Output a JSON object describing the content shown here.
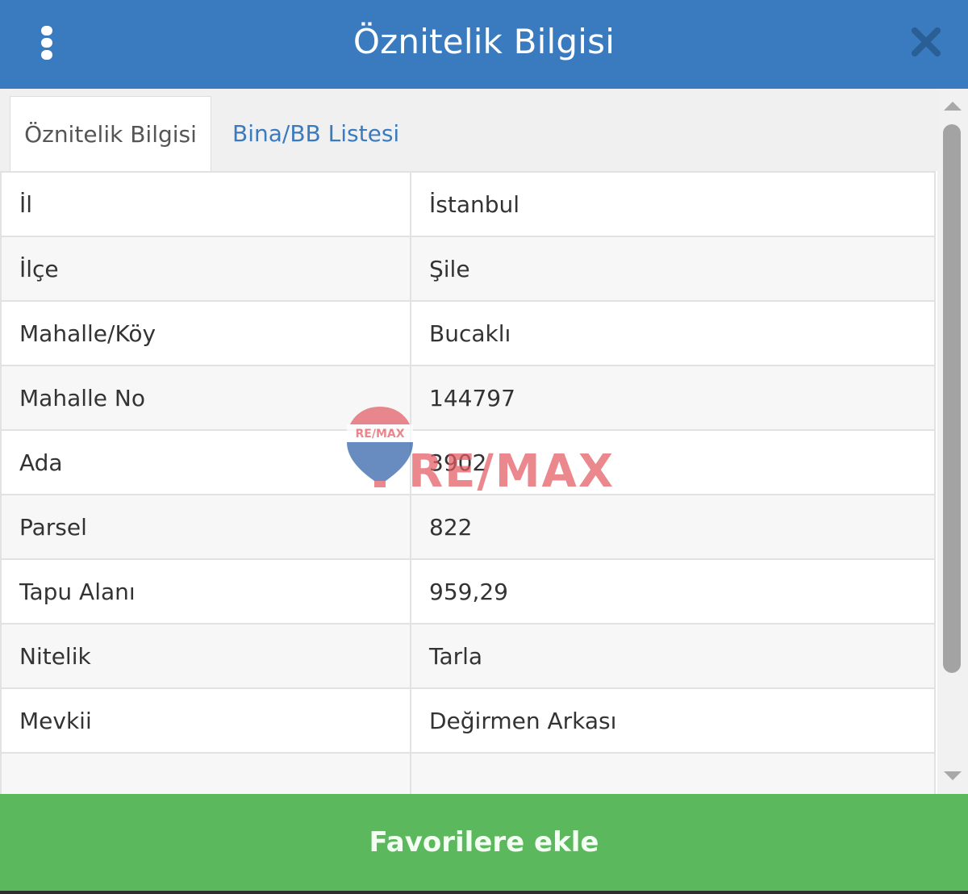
{
  "header": {
    "title": "Öznitelik Bilgisi",
    "menu_icon": "kebab-menu-icon",
    "close_icon": "close-icon"
  },
  "tabs": [
    {
      "label": "Öznitelik Bilgisi",
      "active": true
    },
    {
      "label": "Bina/BB Listesi",
      "active": false
    }
  ],
  "attributes": [
    {
      "key": "İl",
      "value": "İstanbul"
    },
    {
      "key": "İlçe",
      "value": "Şile"
    },
    {
      "key": "Mahalle/Köy",
      "value": "Bucaklı"
    },
    {
      "key": "Mahalle No",
      "value": "144797"
    },
    {
      "key": "Ada",
      "value": "3902"
    },
    {
      "key": "Parsel",
      "value": "822"
    },
    {
      "key": "Tapu Alanı",
      "value": "959,29"
    },
    {
      "key": "Nitelik",
      "value": "Tarla"
    },
    {
      "key": "Mevkii",
      "value": "Değirmen Arkası"
    }
  ],
  "footer": {
    "button_label": "Favorilere ekle"
  },
  "watermark": {
    "badge_text": "RE/MAX",
    "text": "RE/MAX"
  },
  "colors": {
    "header": "#3a7bbf",
    "tab_link": "#3a7bbf",
    "footer_button": "#5cb85c",
    "watermark_red": "#e25b63",
    "watermark_blue": "#2f5fa8"
  }
}
